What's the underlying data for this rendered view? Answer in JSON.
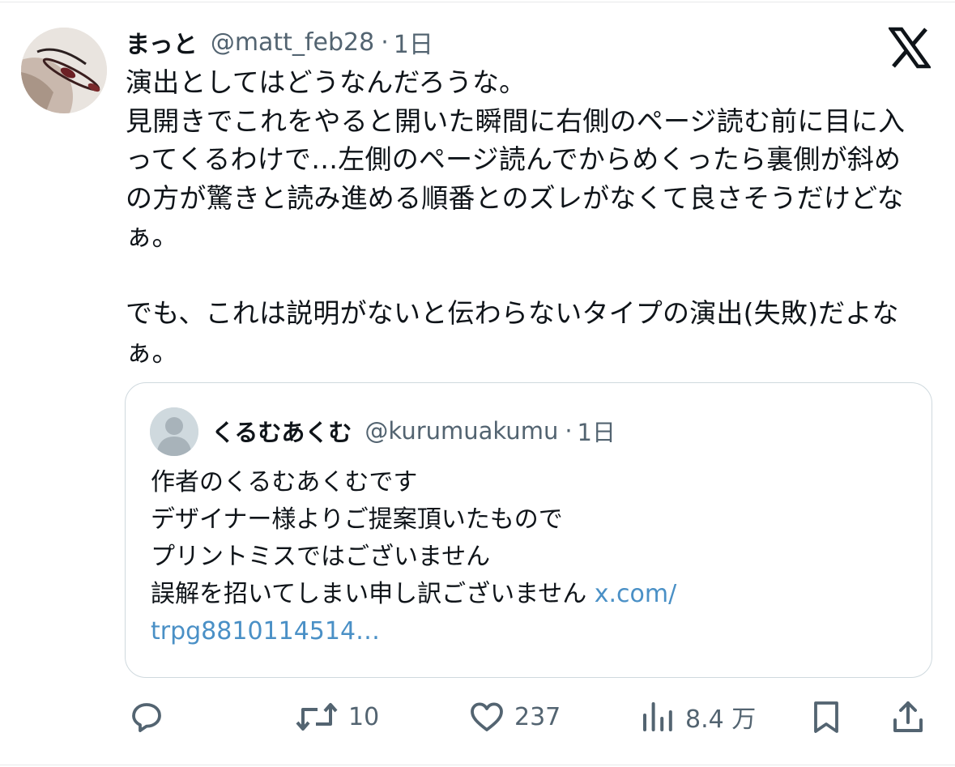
{
  "tweet": {
    "display_name": "まっと",
    "handle": "@matt_feb28",
    "separator": "·",
    "time": "1日",
    "lines": [
      "演出としてはどうなんだろうな。",
      "見開きでこれをやると開いた瞬間に右側のページ読む前に目に入",
      "ってくるわけで…左側のページ読んでからめくったら裏側が斜め",
      "の方が驚きと読み進める順番とのズレがなくて良さそうだけどな",
      "ぁ。",
      "",
      "でも、これは説明がないと伝わらないタイプの演出(失敗)だよな",
      "ぁ。"
    ]
  },
  "quote": {
    "display_name": "くるむあくむ",
    "handle": "@kurumuakumu",
    "separator": "·",
    "time": "1日",
    "lines": [
      "作者のくるむあくむです",
      "デザイナー様よりご提案頂いたもので",
      "プリントミスではございません"
    ],
    "last_line_text": "誤解を招いてしまい申し訳ございません ",
    "link_part1": "x.com/",
    "link_part2": "trpg8810114514…"
  },
  "actions": {
    "reply_icon": "reply-icon",
    "retweet_icon": "retweet-icon",
    "retweet_count": "10",
    "like_icon": "heart-icon",
    "like_count": "237",
    "views_icon": "views-icon",
    "views_count": "8.4 万",
    "bookmark_icon": "bookmark-icon",
    "share_icon": "share-icon"
  },
  "colors": {
    "text": "#0f1419",
    "secondary": "#536471",
    "link": "#4a90c6",
    "border": "#cfd9de"
  }
}
